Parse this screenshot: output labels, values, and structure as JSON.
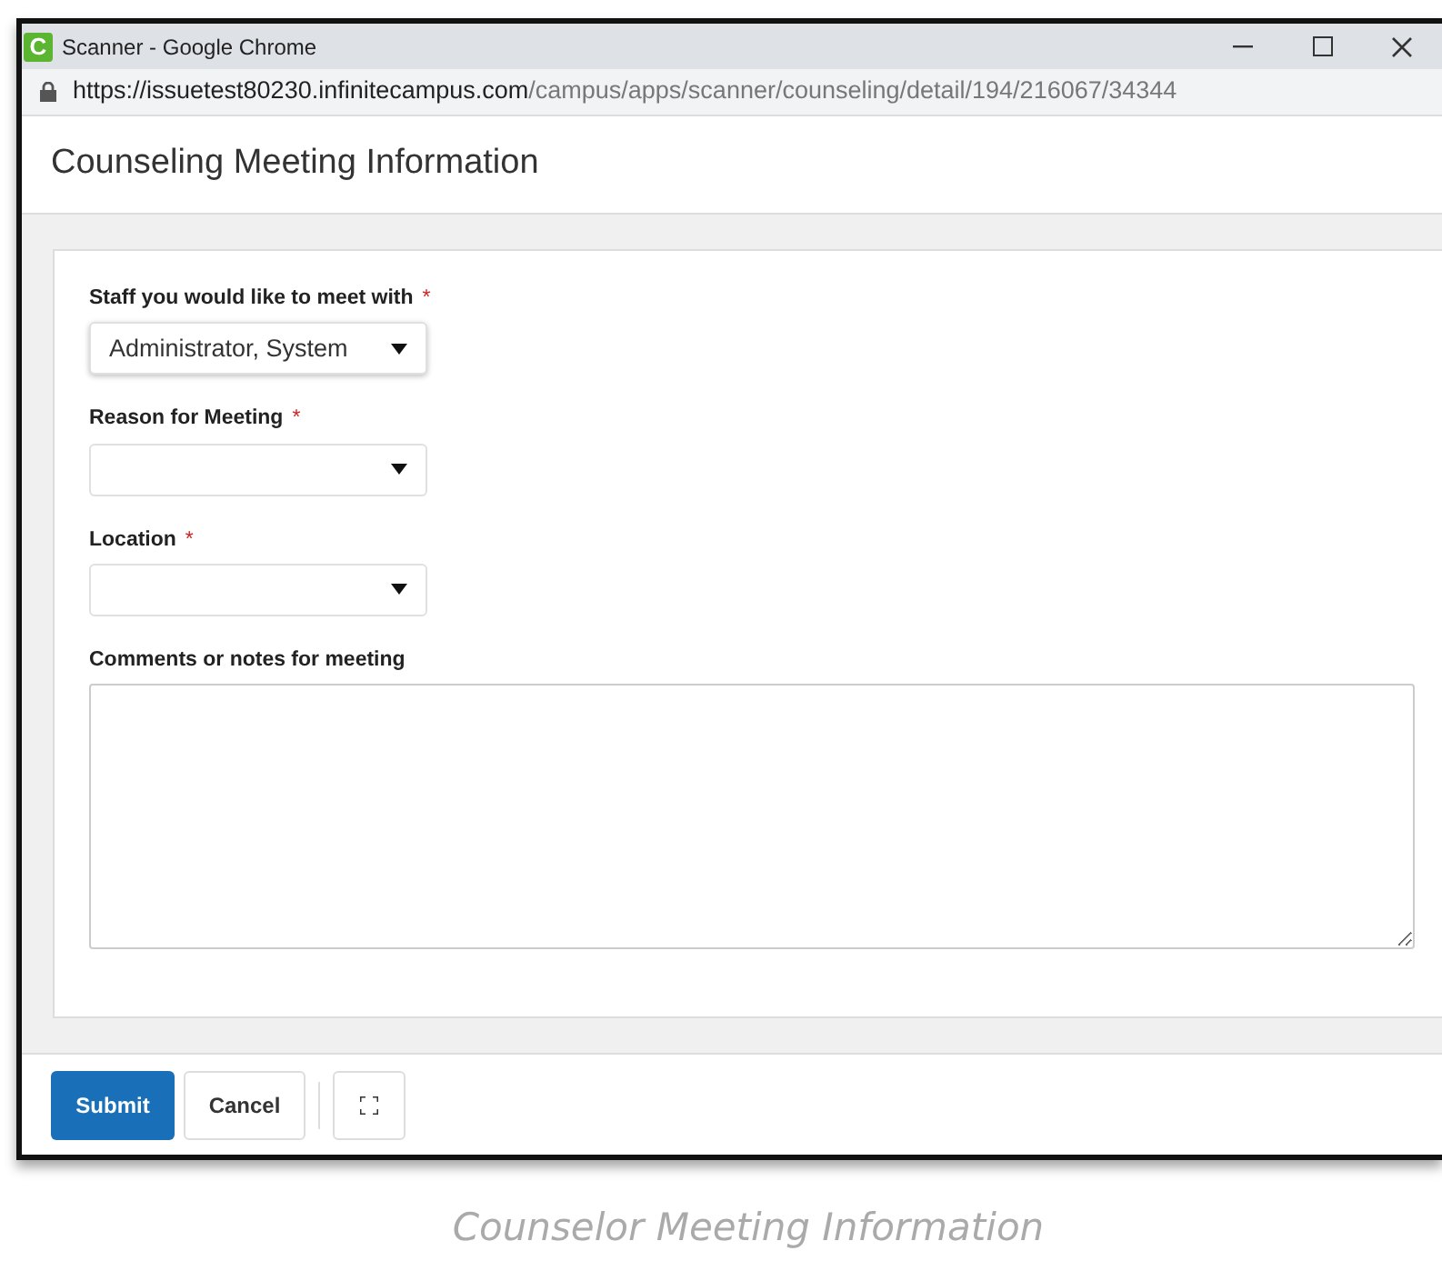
{
  "window": {
    "app_letter": "C",
    "title": "Scanner - Google Chrome"
  },
  "address": {
    "host": "https://issuetest80230.infinitecampus.com",
    "path": "/campus/apps/scanner/counseling/detail/194/216067/34344"
  },
  "page_title": "Counseling Meeting Information",
  "fields": [
    {
      "kind": "select",
      "label": "Staff you would like to meet with",
      "required_mark": "*",
      "value": "Administrator, System"
    },
    {
      "kind": "select",
      "label": "Reason for Meeting",
      "required_mark": "*"
    },
    {
      "kind": "select",
      "label": "Location",
      "required_mark": "*"
    },
    {
      "kind": "textarea",
      "label": "Comments or notes for meeting"
    }
  ],
  "buttons": [
    {
      "kind": "primary",
      "label": "Submit"
    },
    {
      "kind": "secondary",
      "label": "Cancel"
    },
    {
      "kind": "expand"
    }
  ],
  "caption": "Counselor Meeting Information"
}
